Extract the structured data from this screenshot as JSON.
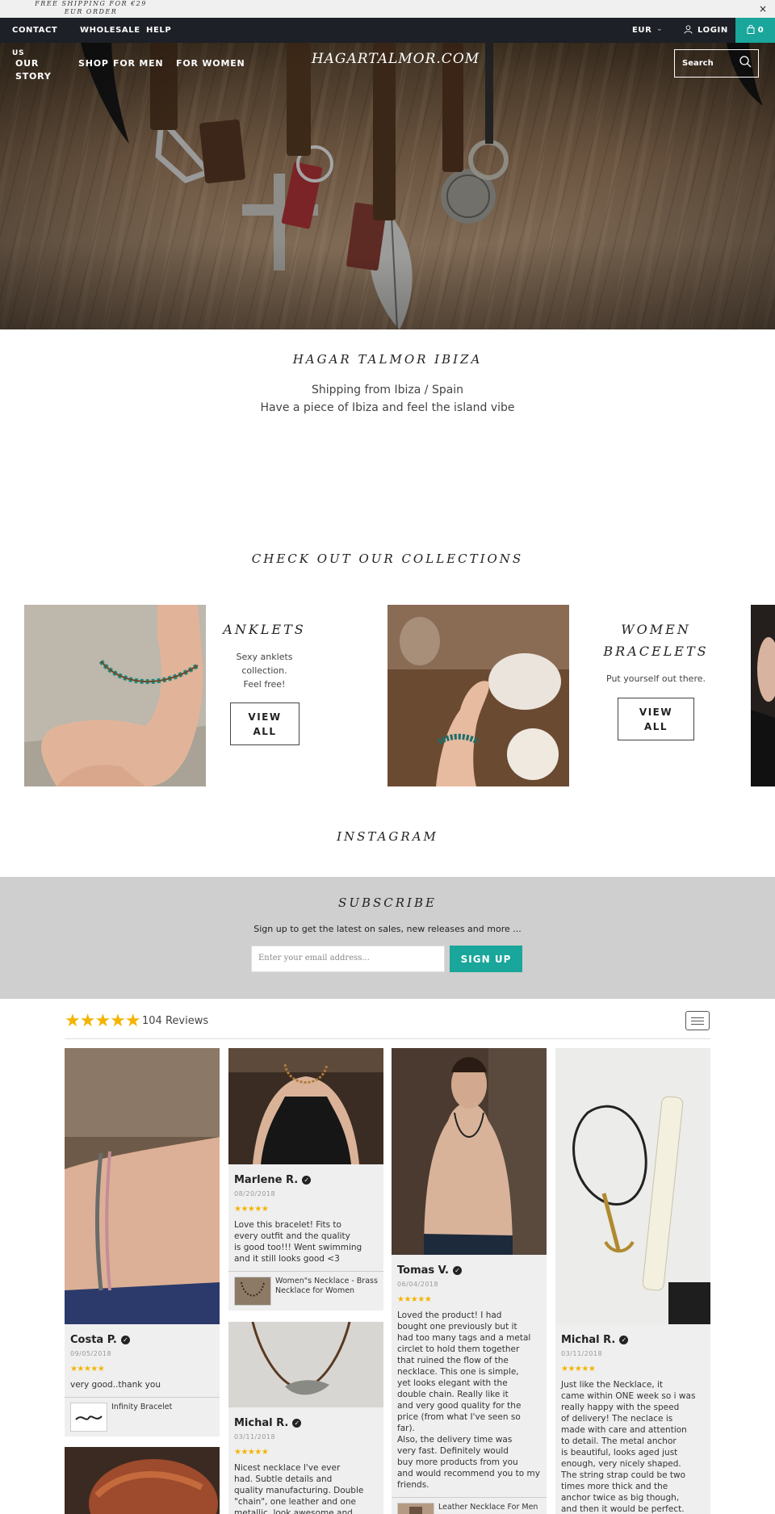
{
  "announcement": {
    "text": "FREE SHIPPING FOR €29 EUR ORDER",
    "close": "×"
  },
  "topbar": {
    "links": [
      "CONTACT",
      "WHOLESALE",
      "HELP"
    ],
    "currency": "EUR",
    "login": "LOGIN",
    "cart_count": "0",
    "accent_color": "#1aa69b"
  },
  "header": {
    "nav": {
      "us_our_story": "US",
      "our": "OUR",
      "story": "STORY",
      "shop": "SHOP",
      "for_men": "FOR MEN",
      "for_women": "FOR WOMEN"
    },
    "logo": "HAGARTALMOR.COM",
    "search_placeholder": "Search"
  },
  "intro": {
    "title": "HAGAR TALMOR IBIZA",
    "line1": "Shipping from Ibiza / Spain",
    "line2": "Have a piece of Ibiza and feel the island vibe"
  },
  "collections": {
    "title": "CHECK OUT OUR COLLECTIONS",
    "items": [
      {
        "name": "ANKLETS",
        "desc1": "Sexy anklets",
        "desc2": "collection.",
        "desc3": "Feel free!",
        "button1": "VIEW",
        "button2": "ALL"
      },
      {
        "name1": "WOMEN",
        "name2": "BRACELETS",
        "desc": "Put yourself out there.",
        "button1": "VIEW",
        "button2": "ALL"
      }
    ]
  },
  "instagram": {
    "title": "INSTAGRAM"
  },
  "subscribe": {
    "title": "SUBSCRIBE",
    "text": "Sign up to get the latest on sales, new releases and more ...",
    "placeholder": "Enter your email address...",
    "button": "SIGN UP"
  },
  "reviews": {
    "stars": "★★★★★",
    "count_label": "104 Reviews",
    "cards": [
      {
        "name": "Costa P.",
        "date": "09/05/2018",
        "stars": "★★★★★",
        "body": "very good..thank you",
        "product": "Infinity Bracelet"
      },
      {
        "name": "Marlene R.",
        "date": "08/20/2018",
        "stars": "★★★★★",
        "body": "Love this bracelet! Fits to\nevery outfit and the quality\nis good too!!! Went swimming\nand it still looks good <3",
        "product": "Women\"s Necklace - Brass Necklace for Women"
      },
      {
        "name": "Michal R.",
        "date": "03/11/2018",
        "stars": "★★★★★",
        "body": "Nicest necklace I've ever\nhad. Subtle details and\nquality manufacturing. Double\n\"chain\", one leather and one\nmetallic, look awesome and"
      },
      {
        "name": "Tomas V.",
        "date": "06/04/2018",
        "stars": "★★★★★",
        "body": "Loved the product! I had\nbought one previously but it\nhad too many tags and a metal\ncirclet to hold them together\nthat ruined the flow of the\nnecklace. This one is simple,\nyet looks elegant with the\ndouble chain. Really like it\nand very good quality for the\nprice (from what I've seen so\nfar).\nAlso, the delivery time was\nvery fast. Definitely would\nbuy more products from you\nand would recommend you to my\nfriends.",
        "product": "Leather Necklace For Men"
      },
      {
        "name": "Michal R.",
        "date": "03/11/2018",
        "stars": "★★★★★",
        "body": "Just like the Necklace, it\ncame within ONE week so i was\nreally happy with the speed\nof delivery! The neclace is\nmade with care and attention\nto detail. The metal anchor\nis beautiful, looks aged just\nenough, very nicely shaped.\nThe string strap could be two\ntimes more thick and the\nanchor twice as big though,\nand then it would be perfect."
      }
    ]
  }
}
